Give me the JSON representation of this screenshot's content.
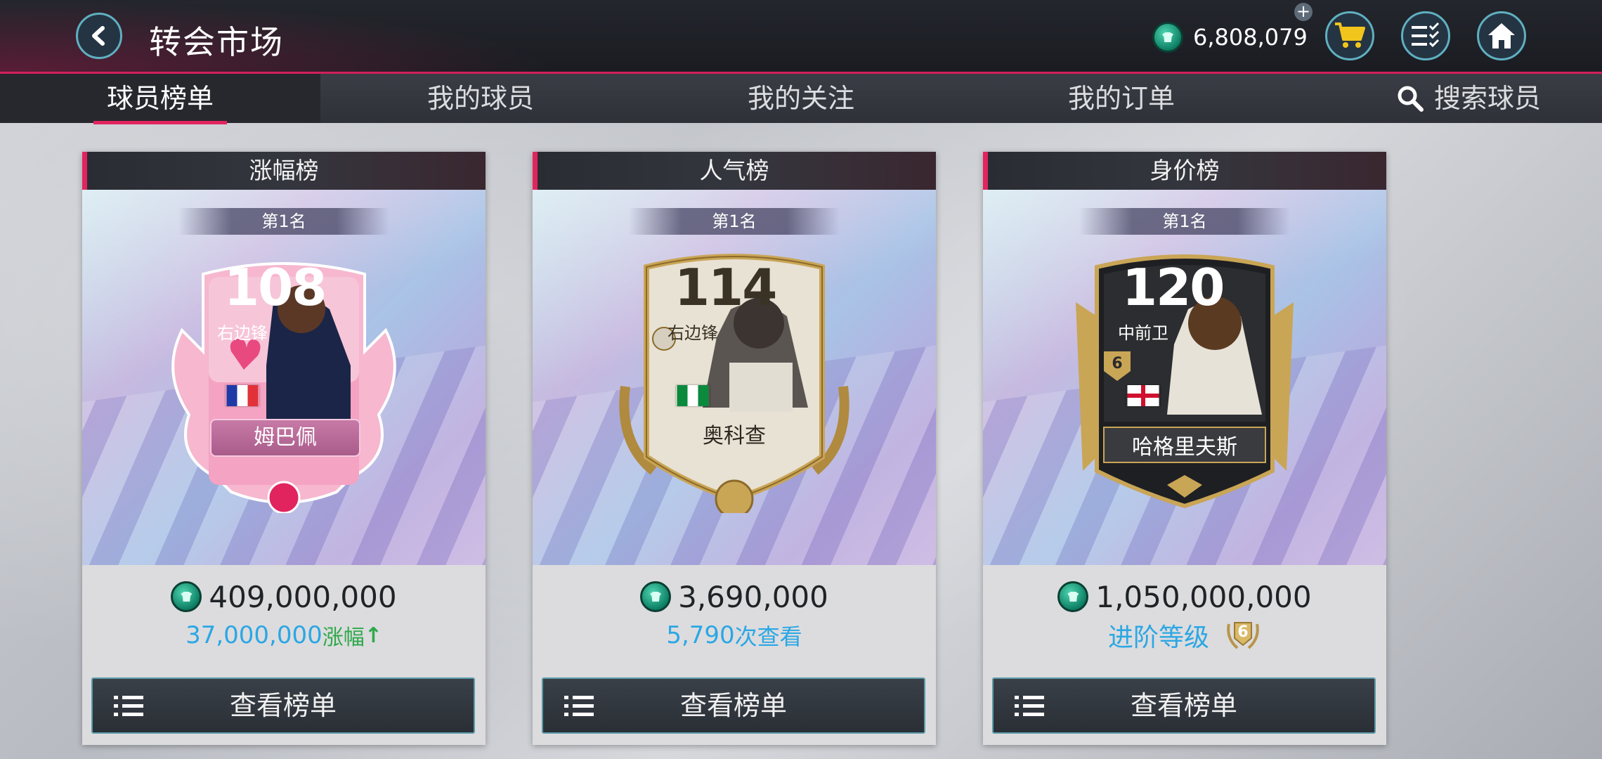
{
  "header": {
    "title": "转会市场",
    "currency_value": "6,808,079",
    "icons": [
      "back-arrow-icon",
      "coin-icon",
      "plus-icon",
      "cart-icon",
      "checklist-icon",
      "home-icon"
    ]
  },
  "tabs": [
    {
      "label": "球员榜单",
      "active": true
    },
    {
      "label": "我的球员",
      "active": false
    },
    {
      "label": "我的关注",
      "active": false
    },
    {
      "label": "我的订单",
      "active": false
    },
    {
      "label": "搜索球员",
      "active": false,
      "icon": "search-icon"
    }
  ],
  "cards": [
    {
      "header": "涨幅榜",
      "rank": "第1名",
      "rating": "108",
      "position": "右边锋",
      "player_name": "姆巴佩",
      "flag": "france-flag",
      "price": "409,000,000",
      "sub_value": "37,000,000",
      "sub_label": "涨幅",
      "sub_arrow": "↑",
      "button": "查看榜单"
    },
    {
      "header": "人气榜",
      "rank": "第1名",
      "rating": "114",
      "position": "右边锋",
      "player_name": "奥科查",
      "flag": "nigeria-flag",
      "price": "3,690,000",
      "sub_value": "5,790",
      "sub_label": "次查看",
      "button": "查看榜单"
    },
    {
      "header": "身价榜",
      "rank": "第1名",
      "rating": "120",
      "position": "中前卫",
      "player_name": "哈格里夫斯",
      "flag": "england-flag",
      "badge_level": "6",
      "price": "1,050,000,000",
      "sub_label": "进阶等级",
      "sub_badge": "6",
      "button": "查看榜单"
    }
  ],
  "colors": {
    "accent": "#e2245e",
    "currency_green": "#0d7f64",
    "highlight_blue": "#2ba7e4",
    "up_green": "#2ea94a"
  }
}
